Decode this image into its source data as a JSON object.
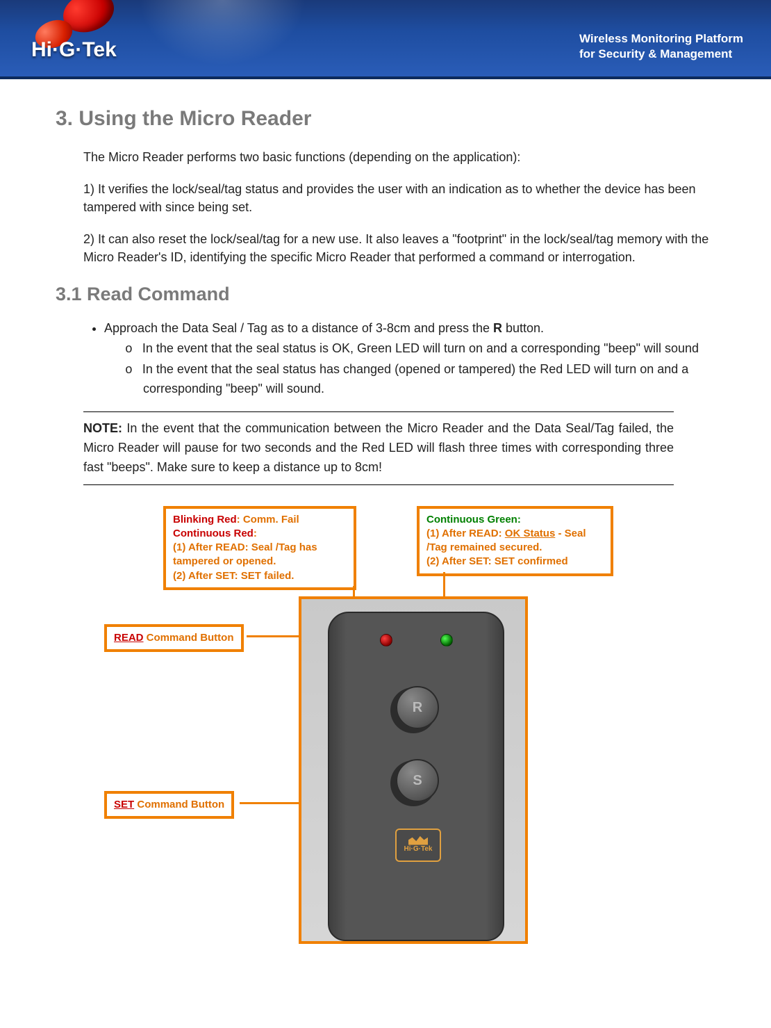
{
  "header": {
    "logo_text": "Hi·G·Tek",
    "tagline_line1": "Wireless Monitoring Platform",
    "tagline_line2": "for Security & Management"
  },
  "section": {
    "title": "3. Using the Micro Reader",
    "intro1": "The Micro Reader performs two basic functions (depending on the application):",
    "intro2": "1) It verifies the lock/seal/tag status and provides the user with an indication as to whether the device has been tampered with since being set.",
    "intro3": " 2) It can also reset the lock/seal/tag for a new use. It also leaves a \"footprint\" in the lock/seal/tag memory with the Micro Reader's ID, identifying the specific Micro Reader that performed a command or interrogation."
  },
  "subsection": {
    "title": "3.1 Read Command",
    "bullet1_pre": "Approach the Data Seal / Tag as to a distance of 3-8cm and press the ",
    "bullet1_bold": "R",
    "bullet1_post": " button.",
    "sub1": "In the event that the seal status is OK, Green LED will turn on and a corresponding \"beep\" will sound",
    "sub2": "In the event that the seal status has changed (opened or tampered) the Red LED will turn on and a corresponding \"beep\" will sound."
  },
  "note": {
    "label": "NOTE:",
    "text": " In the event that the communication between the Micro Reader and the Data Seal/Tag failed, the Micro Reader will pause for two seconds and the Red LED will flash three times with corresponding three fast \"beeps\". Make sure to keep a distance up to 8cm!"
  },
  "diagram": {
    "red_callout": {
      "l1a": "Blinking Red",
      "l1b": ": Comm. Fail",
      "l2a": "Continuous Red",
      "l2b": ":",
      "l3": "(1) After READ:  Seal /Tag has tampered or opened.",
      "l4": "(2) After SET: SET failed."
    },
    "green_callout": {
      "l1": "Continuous Green:",
      "l2a": "(1) After READ:  ",
      "l2b": "OK Status",
      "l2c": " - Seal /Tag remained secured.",
      "l3": "(2) After SET: SET confirmed"
    },
    "read_label_u": "READ",
    "read_label_rest": " Command Button",
    "set_label_u": "SET",
    "set_label_rest": " Command Button",
    "btn_r": "R",
    "btn_s": "S",
    "device_logo": "Hi·G·Tek"
  }
}
